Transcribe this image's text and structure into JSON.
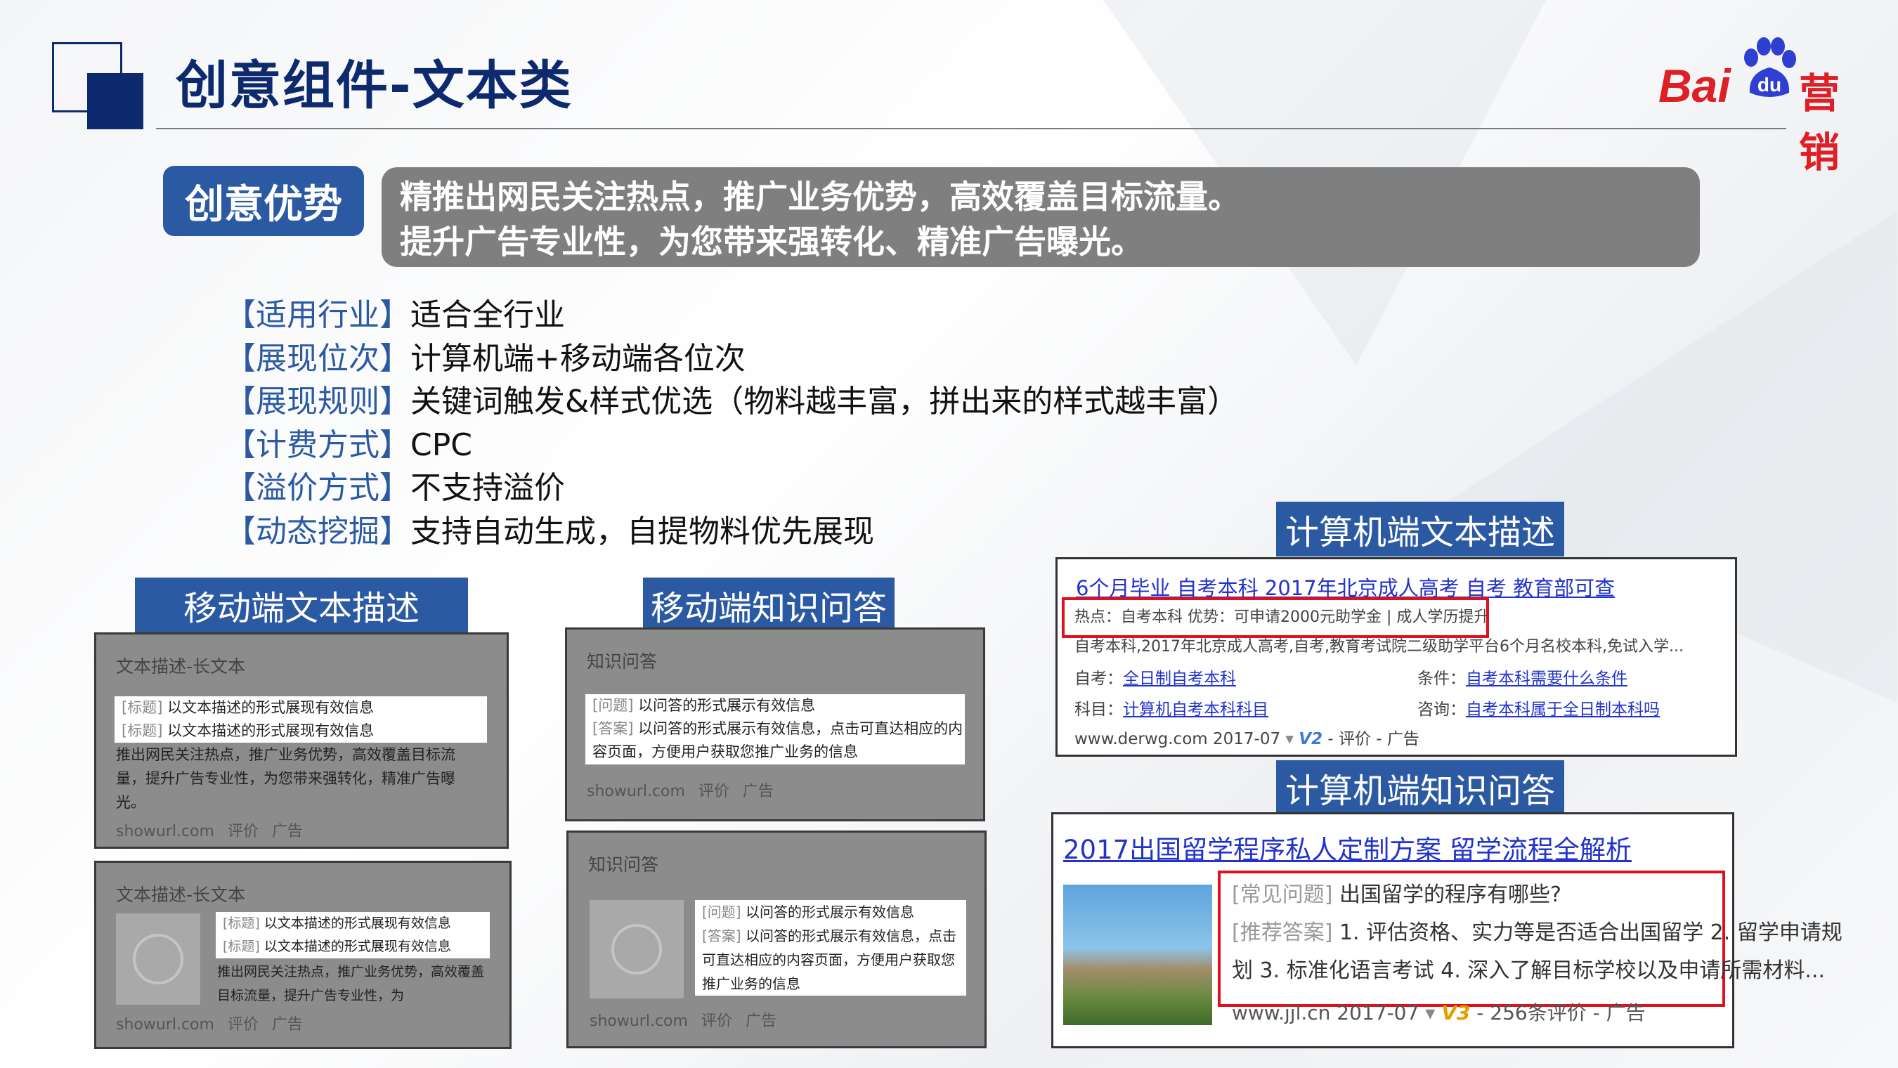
{
  "title": "创意组件-文本类",
  "logo": {
    "bai": "Bai",
    "du": "du",
    "yingxiao": "营销"
  },
  "advantage": {
    "label": "创意优势",
    "line1": "精推出网民关注热点，推广业务优势，高效覆盖目标流量。",
    "line2": "提升广告专业性，为您带来强转化、精准广告曝光。"
  },
  "specs": [
    {
      "key": "【适用行业】",
      "value": "适合全行业"
    },
    {
      "key": "【展现位次】",
      "value": "计算机端+移动端各位次"
    },
    {
      "key": "【展现规则】",
      "value": "关键词触发&样式优选（物料越丰富，拼出来的样式越丰富）"
    },
    {
      "key": "【计费方式】",
      "value": "CPC"
    },
    {
      "key": "【溢价方式】",
      "value": "不支持溢价"
    },
    {
      "key": "【动态挖掘】",
      "value": "支持自动生成，自提物料优先展现"
    }
  ],
  "sections": {
    "mobile_text": "移动端文本描述",
    "mobile_qa": "移动端知识问答",
    "pc_text": "计算机端文本描述",
    "pc_qa": "计算机端知识问答"
  },
  "mobile_text_cards": [
    {
      "title": "文本描述-长文本",
      "tag": "[标题]",
      "tag_text": "以文本描述的形式展现有效信息",
      "body": "推出网民关注热点，推广业务优势，高效覆盖目标流量，提升广告专业性，为您带来强转化，精准广告曝光。",
      "foot": "showurl.com  评价  广告"
    },
    {
      "title": "文本描述-长文本",
      "tag": "[标题]",
      "tag_text": "以文本描述的形式展现有效信息",
      "body": "推出网民关注热点，推广业务优势，高效覆盖目标流量，提升广告专业性，为",
      "foot": "showurl.com  评价  广告"
    }
  ],
  "mobile_qa_cards": [
    {
      "title": "知识问答",
      "q_tag": "[问题]",
      "q": "以问答的形式展示有效信息",
      "a_tag": "[答案]",
      "a": "以问答的形式展示有效信息，点击可直达相应的内容页面，方便用户获取您推广业务的信息",
      "foot": "showurl.com  评价  广告"
    },
    {
      "title": "知识问答",
      "q_tag": "[问题]",
      "q": "以问答的形式展示有效信息",
      "a_tag": "[答案]",
      "a": "以问答的形式展示有效信息，点击可直达相应的内容页面，方便用户获取您推广业务的信息",
      "foot": "showurl.com  评价  广告"
    }
  ],
  "pc_text_ad": {
    "title": "6个月毕业 自考本科 2017年北京成人高考 自考 教育部可查",
    "hot": "热点：自考本科    优势：可申请2000元助学金 | 成人学历提升",
    "desc": "自考本科,2017年北京成人高考,自考,教育考试院二级助学平台6个月名校本科,免试入学...",
    "row1_left_label": "自考：",
    "row1_left": "全日制自考本科",
    "row1_right_label": "条件：",
    "row1_right": "自考本科需要什么条件",
    "row2_left_label": "科目：",
    "row2_left": "计算机自考本科科目",
    "row2_right_label": "咨询：",
    "row2_right": "自考本科属于全日制本科吗",
    "foot_url": "www.derwg.com  2017-07",
    "foot_v": "V2",
    "foot_rest": "- 评价 - 广告"
  },
  "pc_qa_ad": {
    "title": "2017出国留学程序私人定制方案 留学流程全解析",
    "q_tag": "[常见问题]",
    "q": "出国留学的程序有哪些?",
    "a_tag": "[推荐答案]",
    "a1": "1. 评估资格、实力等是否适合出国留学 2. 留学申请规",
    "a2": "划  3. 标准化语言考试  4. 深入了解目标学校以及申请所需材料...",
    "foot_url": "www.jjl.cn  2017-07",
    "foot_v": "V3",
    "foot_rest": "- 256条评价 - 广告"
  },
  "colors": {
    "navy": "#0e2a6e",
    "blue": "#2b5aa3",
    "red": "#de1f26",
    "gray": "#7f7f7f"
  }
}
